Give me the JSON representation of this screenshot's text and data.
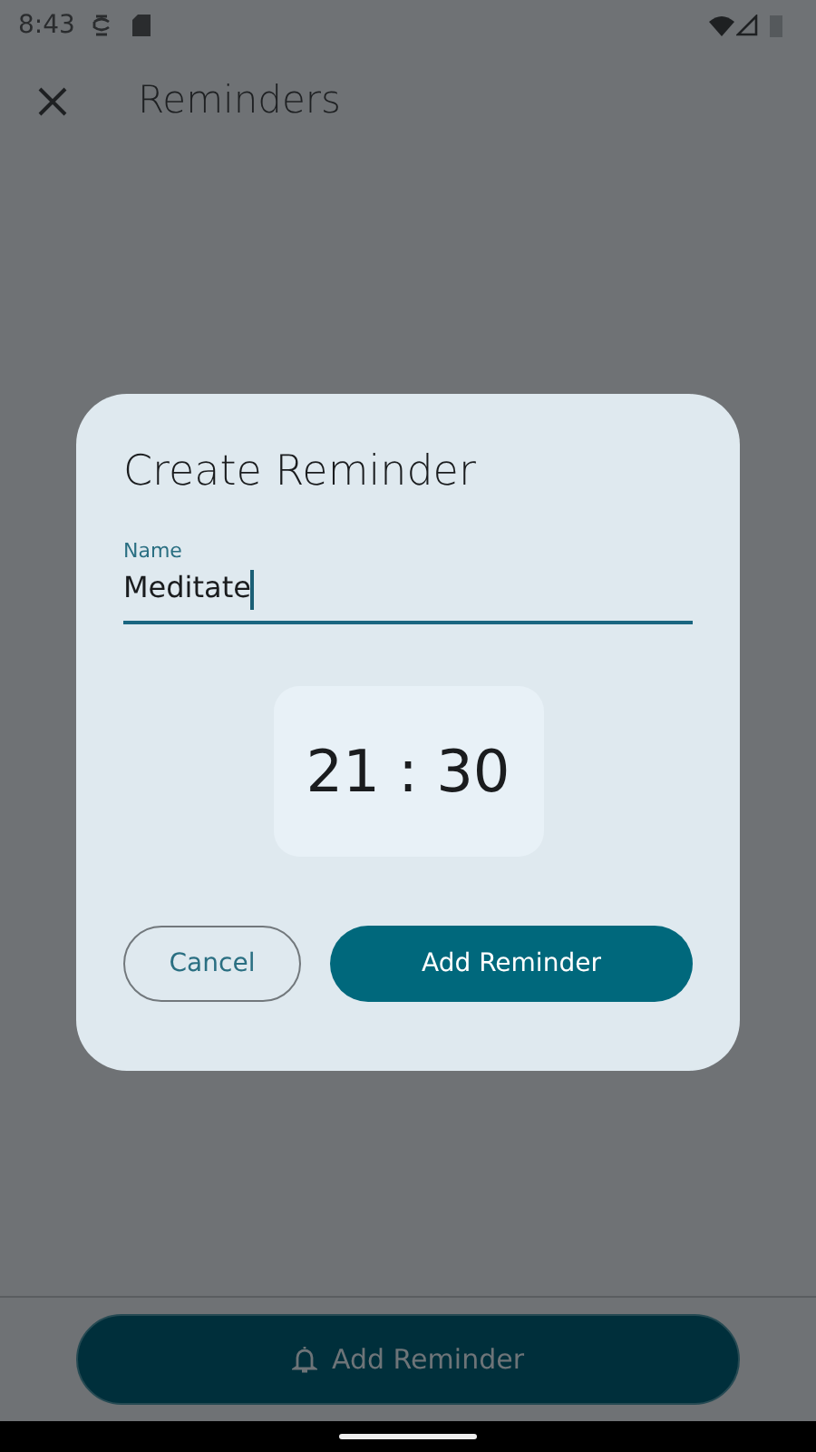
{
  "status_bar": {
    "time": "8:43"
  },
  "app_bar": {
    "title": "Reminders"
  },
  "dialog": {
    "title": "Create Reminder",
    "name_field": {
      "label": "Name",
      "value": "Meditate",
      "focused": true
    },
    "time": "21 : 30",
    "buttons": [
      {
        "label": "Cancel",
        "kind": "outlined"
      },
      {
        "label": "Add Reminder",
        "kind": "filled"
      }
    ]
  },
  "bottom_button": {
    "label": "Add Reminder"
  }
}
